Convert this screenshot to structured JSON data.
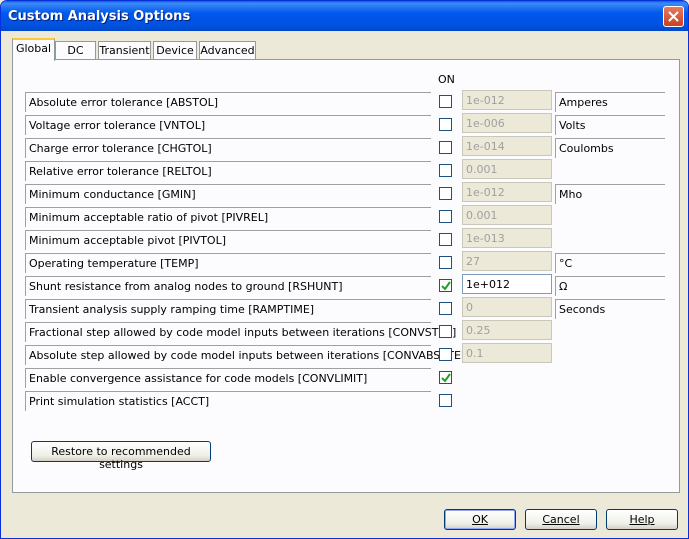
{
  "window": {
    "title": "Custom Analysis Options"
  },
  "tabs": [
    {
      "label": "Global",
      "active": true
    },
    {
      "label": "DC",
      "active": false
    },
    {
      "label": "Transient",
      "active": false
    },
    {
      "label": "Device",
      "active": false
    },
    {
      "label": "Advanced",
      "active": false
    }
  ],
  "table": {
    "on_header": "ON"
  },
  "rows": [
    {
      "label": "Absolute error tolerance [ABSTOL]",
      "checked": false,
      "value": "1e-012",
      "unit": "Amperes"
    },
    {
      "label": "Voltage error tolerance [VNTOL]",
      "checked": false,
      "value": "1e-006",
      "unit": "Volts"
    },
    {
      "label": "Charge error tolerance [CHGTOL]",
      "checked": false,
      "value": "1e-014",
      "unit": "Coulombs"
    },
    {
      "label": "Relative error tolerance [RELTOL]",
      "checked": false,
      "value": "0.001",
      "unit": ""
    },
    {
      "label": "Minimum conductance [GMIN]",
      "checked": false,
      "value": "1e-012",
      "unit": "Mho"
    },
    {
      "label": "Minimum acceptable ratio of pivot [PIVREL]",
      "checked": false,
      "value": "0.001",
      "unit": ""
    },
    {
      "label": "Minimum acceptable pivot [PIVTOL]",
      "checked": false,
      "value": "1e-013",
      "unit": ""
    },
    {
      "label": "Operating temperature [TEMP]",
      "checked": false,
      "value": "27",
      "unit": "°C"
    },
    {
      "label": "Shunt resistance from analog nodes to ground [RSHUNT]",
      "checked": true,
      "value": "1e+012",
      "unit": "Ω"
    },
    {
      "label": "Transient analysis supply ramping time [RAMPTIME]",
      "checked": false,
      "value": "0",
      "unit": "Seconds"
    },
    {
      "label": "Fractional step allowed by code model inputs between iterations [CONVSTEP]",
      "checked": false,
      "value": "0.25",
      "unit": ""
    },
    {
      "label": "Absolute step allowed by code model inputs between iterations [CONVABSSTEP]",
      "checked": false,
      "value": "0.1",
      "unit": ""
    },
    {
      "label": "Enable convergence assistance for code models [CONVLIMIT]",
      "checked": true,
      "value": "",
      "unit": ""
    },
    {
      "label": "Print simulation statistics [ACCT]",
      "checked": false,
      "value": "",
      "unit": ""
    }
  ],
  "buttons": {
    "restore": "Restore to recommended settings",
    "ok": "OK",
    "cancel": "Cancel",
    "help": "Help"
  }
}
